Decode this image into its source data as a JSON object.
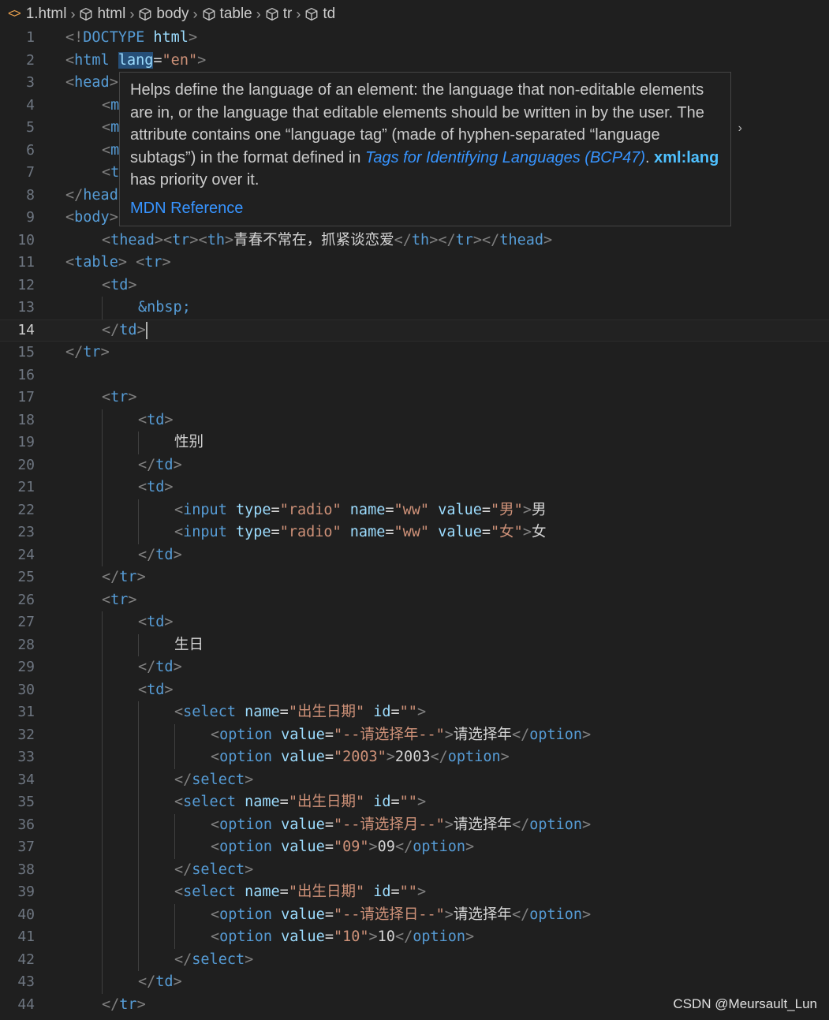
{
  "breadcrumb": {
    "file": "1.html",
    "items": [
      "html",
      "body",
      "table",
      "tr",
      "td"
    ]
  },
  "lines": [
    {
      "n": "1",
      "indent": 0,
      "tokens": [
        [
          "b",
          "<!"
        ],
        [
          "tag",
          "DOCTYPE"
        ],
        [
          "txt",
          " "
        ],
        [
          "attr",
          "html"
        ],
        [
          "b",
          ">"
        ]
      ]
    },
    {
      "n": "2",
      "indent": 0,
      "tokens": [
        [
          "b",
          "<"
        ],
        [
          "tag",
          "html"
        ],
        [
          "txt",
          " "
        ],
        [
          "attrhl",
          "lang"
        ],
        [
          "txt",
          "="
        ],
        [
          "str",
          "\"en\""
        ],
        [
          "b",
          ">"
        ]
      ]
    },
    {
      "n": "3",
      "indent": 0,
      "tokens": [
        [
          "b",
          "<"
        ],
        [
          "tag",
          "head"
        ],
        [
          "b",
          ">"
        ]
      ]
    },
    {
      "n": "4",
      "indent": 1,
      "tokens": [
        [
          "b",
          "<"
        ],
        [
          "tag",
          "m"
        ]
      ]
    },
    {
      "n": "5",
      "indent": 1,
      "tokens": [
        [
          "b",
          "<"
        ],
        [
          "tag",
          "m"
        ]
      ]
    },
    {
      "n": "6",
      "indent": 1,
      "tokens": [
        [
          "b",
          "<"
        ],
        [
          "tag",
          "m"
        ]
      ]
    },
    {
      "n": "7",
      "indent": 1,
      "tokens": [
        [
          "b",
          "<"
        ],
        [
          "tag",
          "t"
        ]
      ]
    },
    {
      "n": "8",
      "indent": 0,
      "tokens": [
        [
          "b",
          "</"
        ],
        [
          "tag",
          "head"
        ]
      ]
    },
    {
      "n": "9",
      "indent": 0,
      "tokens": [
        [
          "b",
          "<"
        ],
        [
          "tag",
          "body"
        ],
        [
          "b",
          ">"
        ]
      ]
    },
    {
      "n": "10",
      "indent": 1,
      "tokens": [
        [
          "b",
          "<"
        ],
        [
          "tag",
          "thead"
        ],
        [
          "b",
          "><"
        ],
        [
          "tag",
          "tr"
        ],
        [
          "b",
          "><"
        ],
        [
          "tag",
          "th"
        ],
        [
          "b",
          ">"
        ],
        [
          "txt",
          "青春不常在，抓紧谈恋爱"
        ],
        [
          "b",
          "</"
        ],
        [
          "tag",
          "th"
        ],
        [
          "b",
          "></"
        ],
        [
          "tag",
          "tr"
        ],
        [
          "b",
          "></"
        ],
        [
          "tag",
          "thead"
        ],
        [
          "b",
          ">"
        ]
      ]
    },
    {
      "n": "11",
      "indent": 0,
      "tokens": [
        [
          "b",
          "<"
        ],
        [
          "tag",
          "table"
        ],
        [
          "b",
          ">"
        ],
        [
          "txt",
          " "
        ],
        [
          "b",
          "<"
        ],
        [
          "tag",
          "tr"
        ],
        [
          "b",
          ">"
        ]
      ]
    },
    {
      "n": "12",
      "indent": 1,
      "tokens": [
        [
          "b",
          "<"
        ],
        [
          "tag",
          "td"
        ],
        [
          "b",
          ">"
        ]
      ]
    },
    {
      "n": "13",
      "indent": 2,
      "tokens": [
        [
          "ent",
          "&nbsp;"
        ]
      ]
    },
    {
      "n": "14",
      "indent": 1,
      "current": true,
      "tokens": [
        [
          "b",
          "</"
        ],
        [
          "tag",
          "td"
        ],
        [
          "b",
          ">"
        ],
        [
          "cursor",
          ""
        ]
      ]
    },
    {
      "n": "15",
      "indent": 0,
      "tokens": [
        [
          "b",
          "</"
        ],
        [
          "tag",
          "tr"
        ],
        [
          "b",
          ">"
        ]
      ]
    },
    {
      "n": "16",
      "indent": 0,
      "tokens": []
    },
    {
      "n": "17",
      "indent": 1,
      "tokens": [
        [
          "b",
          "<"
        ],
        [
          "tag",
          "tr"
        ],
        [
          "b",
          ">"
        ]
      ]
    },
    {
      "n": "18",
      "indent": 2,
      "tokens": [
        [
          "b",
          "<"
        ],
        [
          "tag",
          "td"
        ],
        [
          "b",
          ">"
        ]
      ]
    },
    {
      "n": "19",
      "indent": 3,
      "tokens": [
        [
          "txt",
          "性别"
        ]
      ]
    },
    {
      "n": "20",
      "indent": 2,
      "tokens": [
        [
          "b",
          "</"
        ],
        [
          "tag",
          "td"
        ],
        [
          "b",
          ">"
        ]
      ]
    },
    {
      "n": "21",
      "indent": 2,
      "tokens": [
        [
          "b",
          "<"
        ],
        [
          "tag",
          "td"
        ],
        [
          "b",
          ">"
        ]
      ]
    },
    {
      "n": "22",
      "indent": 3,
      "tokens": [
        [
          "b",
          "<"
        ],
        [
          "tag",
          "input"
        ],
        [
          "txt",
          " "
        ],
        [
          "attr",
          "type"
        ],
        [
          "txt",
          "="
        ],
        [
          "str",
          "\"radio\""
        ],
        [
          "txt",
          " "
        ],
        [
          "attr",
          "name"
        ],
        [
          "txt",
          "="
        ],
        [
          "str",
          "\"ww\""
        ],
        [
          "txt",
          " "
        ],
        [
          "attr",
          "value"
        ],
        [
          "txt",
          "="
        ],
        [
          "str",
          "\"男\""
        ],
        [
          "b",
          ">"
        ],
        [
          "txt",
          "男"
        ]
      ]
    },
    {
      "n": "23",
      "indent": 3,
      "tokens": [
        [
          "b",
          "<"
        ],
        [
          "tag",
          "input"
        ],
        [
          "txt",
          " "
        ],
        [
          "attr",
          "type"
        ],
        [
          "txt",
          "="
        ],
        [
          "str",
          "\"radio\""
        ],
        [
          "txt",
          " "
        ],
        [
          "attr",
          "name"
        ],
        [
          "txt",
          "="
        ],
        [
          "str",
          "\"ww\""
        ],
        [
          "txt",
          " "
        ],
        [
          "attr",
          "value"
        ],
        [
          "txt",
          "="
        ],
        [
          "str",
          "\"女\""
        ],
        [
          "b",
          ">"
        ],
        [
          "txt",
          "女"
        ]
      ]
    },
    {
      "n": "24",
      "indent": 2,
      "tokens": [
        [
          "b",
          "</"
        ],
        [
          "tag",
          "td"
        ],
        [
          "b",
          ">"
        ]
      ]
    },
    {
      "n": "25",
      "indent": 1,
      "tokens": [
        [
          "b",
          "</"
        ],
        [
          "tag",
          "tr"
        ],
        [
          "b",
          ">"
        ]
      ]
    },
    {
      "n": "26",
      "indent": 1,
      "tokens": [
        [
          "b",
          "<"
        ],
        [
          "tag",
          "tr"
        ],
        [
          "b",
          ">"
        ]
      ]
    },
    {
      "n": "27",
      "indent": 2,
      "tokens": [
        [
          "b",
          "<"
        ],
        [
          "tag",
          "td"
        ],
        [
          "b",
          ">"
        ]
      ]
    },
    {
      "n": "28",
      "indent": 3,
      "tokens": [
        [
          "txt",
          "生日"
        ]
      ]
    },
    {
      "n": "29",
      "indent": 2,
      "tokens": [
        [
          "b",
          "</"
        ],
        [
          "tag",
          "td"
        ],
        [
          "b",
          ">"
        ]
      ]
    },
    {
      "n": "30",
      "indent": 2,
      "tokens": [
        [
          "b",
          "<"
        ],
        [
          "tag",
          "td"
        ],
        [
          "b",
          ">"
        ]
      ]
    },
    {
      "n": "31",
      "indent": 3,
      "tokens": [
        [
          "b",
          "<"
        ],
        [
          "tag",
          "select"
        ],
        [
          "txt",
          " "
        ],
        [
          "attr",
          "name"
        ],
        [
          "txt",
          "="
        ],
        [
          "str",
          "\"出生日期\""
        ],
        [
          "txt",
          " "
        ],
        [
          "attr",
          "id"
        ],
        [
          "txt",
          "="
        ],
        [
          "str",
          "\"\""
        ],
        [
          "b",
          ">"
        ]
      ]
    },
    {
      "n": "32",
      "indent": 4,
      "tokens": [
        [
          "b",
          "<"
        ],
        [
          "tag",
          "option"
        ],
        [
          "txt",
          " "
        ],
        [
          "attr",
          "value"
        ],
        [
          "txt",
          "="
        ],
        [
          "str",
          "\"--请选择年--\""
        ],
        [
          "b",
          ">"
        ],
        [
          "txt",
          "请选择年"
        ],
        [
          "b",
          "</"
        ],
        [
          "tag",
          "option"
        ],
        [
          "b",
          ">"
        ]
      ]
    },
    {
      "n": "33",
      "indent": 4,
      "tokens": [
        [
          "b",
          "<"
        ],
        [
          "tag",
          "option"
        ],
        [
          "txt",
          " "
        ],
        [
          "attr",
          "value"
        ],
        [
          "txt",
          "="
        ],
        [
          "str",
          "\"2003\""
        ],
        [
          "b",
          ">"
        ],
        [
          "txt",
          "2003"
        ],
        [
          "b",
          "</"
        ],
        [
          "tag",
          "option"
        ],
        [
          "b",
          ">"
        ]
      ]
    },
    {
      "n": "34",
      "indent": 3,
      "tokens": [
        [
          "b",
          "</"
        ],
        [
          "tag",
          "select"
        ],
        [
          "b",
          ">"
        ]
      ]
    },
    {
      "n": "35",
      "indent": 3,
      "tokens": [
        [
          "b",
          "<"
        ],
        [
          "tag",
          "select"
        ],
        [
          "txt",
          " "
        ],
        [
          "attr",
          "name"
        ],
        [
          "txt",
          "="
        ],
        [
          "str",
          "\"出生日期\""
        ],
        [
          "txt",
          " "
        ],
        [
          "attr",
          "id"
        ],
        [
          "txt",
          "="
        ],
        [
          "str",
          "\"\""
        ],
        [
          "b",
          ">"
        ]
      ]
    },
    {
      "n": "36",
      "indent": 4,
      "tokens": [
        [
          "b",
          "<"
        ],
        [
          "tag",
          "option"
        ],
        [
          "txt",
          " "
        ],
        [
          "attr",
          "value"
        ],
        [
          "txt",
          "="
        ],
        [
          "str",
          "\"--请选择月--\""
        ],
        [
          "b",
          ">"
        ],
        [
          "txt",
          "请选择年"
        ],
        [
          "b",
          "</"
        ],
        [
          "tag",
          "option"
        ],
        [
          "b",
          ">"
        ]
      ]
    },
    {
      "n": "37",
      "indent": 4,
      "tokens": [
        [
          "b",
          "<"
        ],
        [
          "tag",
          "option"
        ],
        [
          "txt",
          " "
        ],
        [
          "attr",
          "value"
        ],
        [
          "txt",
          "="
        ],
        [
          "str",
          "\"09\""
        ],
        [
          "b",
          ">"
        ],
        [
          "txt",
          "09"
        ],
        [
          "b",
          "</"
        ],
        [
          "tag",
          "option"
        ],
        [
          "b",
          ">"
        ]
      ]
    },
    {
      "n": "38",
      "indent": 3,
      "tokens": [
        [
          "b",
          "</"
        ],
        [
          "tag",
          "select"
        ],
        [
          "b",
          ">"
        ]
      ]
    },
    {
      "n": "39",
      "indent": 3,
      "tokens": [
        [
          "b",
          "<"
        ],
        [
          "tag",
          "select"
        ],
        [
          "txt",
          " "
        ],
        [
          "attr",
          "name"
        ],
        [
          "txt",
          "="
        ],
        [
          "str",
          "\"出生日期\""
        ],
        [
          "txt",
          " "
        ],
        [
          "attr",
          "id"
        ],
        [
          "txt",
          "="
        ],
        [
          "str",
          "\"\""
        ],
        [
          "b",
          ">"
        ]
      ]
    },
    {
      "n": "40",
      "indent": 4,
      "tokens": [
        [
          "b",
          "<"
        ],
        [
          "tag",
          "option"
        ],
        [
          "txt",
          " "
        ],
        [
          "attr",
          "value"
        ],
        [
          "txt",
          "="
        ],
        [
          "str",
          "\"--请选择日--\""
        ],
        [
          "b",
          ">"
        ],
        [
          "txt",
          "请选择年"
        ],
        [
          "b",
          "</"
        ],
        [
          "tag",
          "option"
        ],
        [
          "b",
          ">"
        ]
      ]
    },
    {
      "n": "41",
      "indent": 4,
      "tokens": [
        [
          "b",
          "<"
        ],
        [
          "tag",
          "option"
        ],
        [
          "txt",
          " "
        ],
        [
          "attr",
          "value"
        ],
        [
          "txt",
          "="
        ],
        [
          "str",
          "\"10\""
        ],
        [
          "b",
          ">"
        ],
        [
          "txt",
          "10"
        ],
        [
          "b",
          "</"
        ],
        [
          "tag",
          "option"
        ],
        [
          "b",
          ">"
        ]
      ]
    },
    {
      "n": "42",
      "indent": 3,
      "tokens": [
        [
          "b",
          "</"
        ],
        [
          "tag",
          "select"
        ],
        [
          "b",
          ">"
        ]
      ]
    },
    {
      "n": "43",
      "indent": 2,
      "tokens": [
        [
          "b",
          "</"
        ],
        [
          "tag",
          "td"
        ],
        [
          "b",
          ">"
        ]
      ]
    },
    {
      "n": "44",
      "indent": 1,
      "tokens": [
        [
          "b",
          "</"
        ],
        [
          "tag",
          "tr"
        ],
        [
          "b",
          ">"
        ]
      ]
    }
  ],
  "hover": {
    "text1": "Helps define the language of an element: the language that non-editable elements are in, or the language that editable elements should be written in by the user. The attribute contains one “language tag” (made of hyphen-separated “language subtags”) in the format defined in ",
    "link": "Tags for Identifying Languages (BCP47)",
    "text2": ". ",
    "bold": "xml:lang",
    "text3": " has priority over it.",
    "reference": "MDN Reference"
  },
  "watermark": "CSDN @Meursault_Lun",
  "colors": {
    "background": "#1f1f1f",
    "tag": "#569cd6",
    "attribute": "#9cdcfe",
    "string": "#ce9178",
    "bracket": "#808080",
    "link": "#3794ff"
  }
}
